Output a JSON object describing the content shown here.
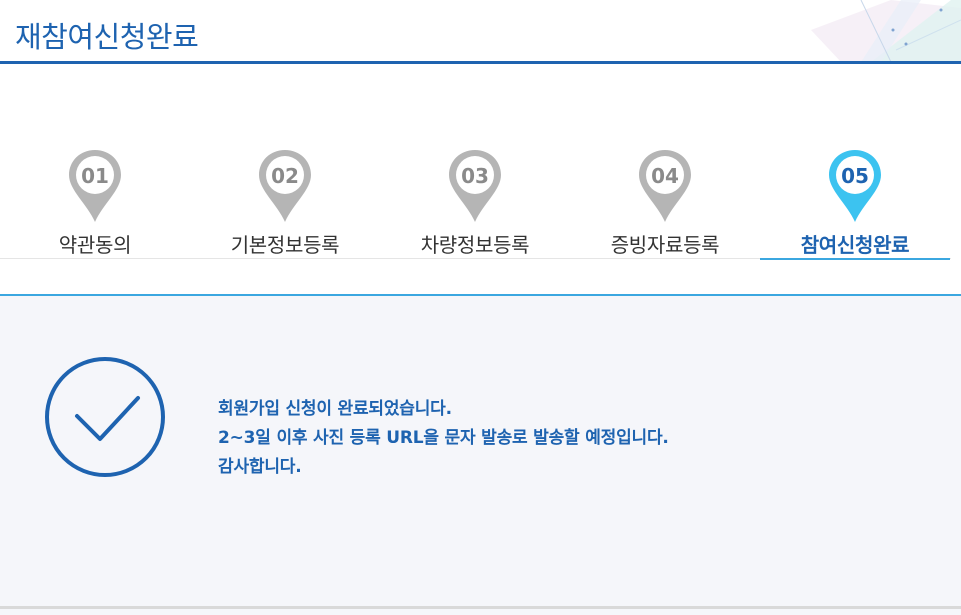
{
  "header": {
    "title": "재참여신청완료"
  },
  "steps": [
    {
      "number": "01",
      "label": "약관동의",
      "active": false
    },
    {
      "number": "02",
      "label": "기본정보등록",
      "active": false
    },
    {
      "number": "03",
      "label": "차량정보등록",
      "active": false
    },
    {
      "number": "04",
      "label": "증빙자료등록",
      "active": false
    },
    {
      "number": "05",
      "label": "참여신청완료",
      "active": true
    }
  ],
  "colors": {
    "primary": "#1e63b0",
    "active_pin": "#3cc3f0",
    "inactive_pin": "#b5b5b5"
  },
  "completion": {
    "line1": "회원가입 신청이 완료되었습니다.",
    "line2": "2~3일 이후 사진 등록 URL을 문자 발송로 발송할 예정입니다.",
    "line3": "감사합니다."
  }
}
